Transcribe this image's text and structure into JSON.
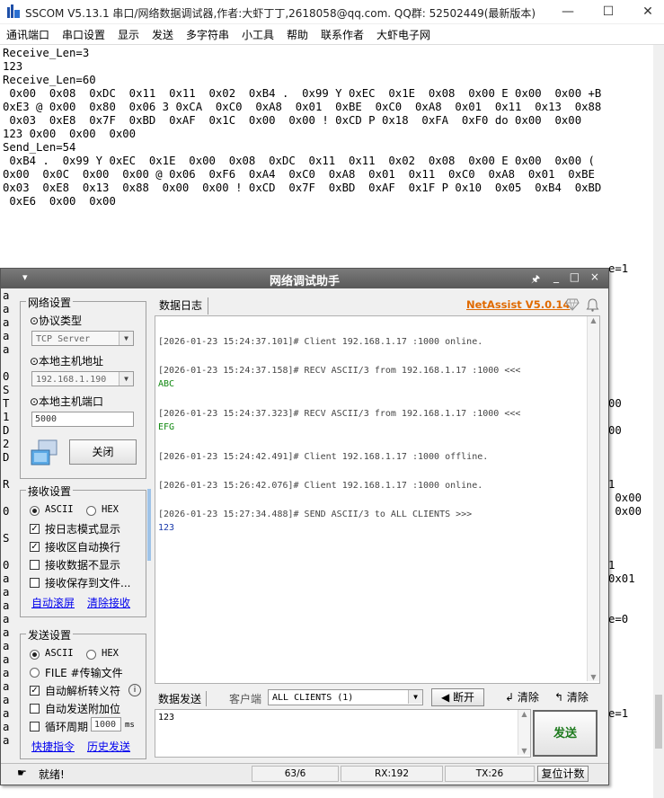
{
  "sscom": {
    "title": "SSCOM V5.13.1 串口/网络数据调试器,作者:大虾丁丁,2618058@qq.com. QQ群: 52502449(最新版本)",
    "menu": [
      "通讯端口",
      "串口设置",
      "显示",
      "发送",
      "多字符串",
      "小工具",
      "帮助",
      "联系作者",
      "大虾电子网"
    ],
    "window_controls": {
      "minimize": "—",
      "maximize": "☐",
      "close": "✕"
    },
    "text_lines": [
      "Receive_Len=3",
      "123",
      "",
      "Receive_Len=60",
      " 0x00  0x08  0xDC  0x11  0x11  0x02  0xB4 .  0x99 Y 0xEC  0x1E  0x08  0x00 E 0x00  0x00 +B",
      "0xE3 @ 0x00  0x80  0x06 3 0xCA  0xC0  0xA8  0x01  0xBE  0xC0  0xA8  0x01  0x11  0x13  0x88",
      " 0x03  0xE8  0x7F  0xBD  0xAF  0x1C  0x00  0x00 ! 0xCD P 0x18  0xFA  0xF0 do 0x00  0x00",
      "123 0x00  0x00  0x00",
      "",
      "Send_Len=54",
      " 0xB4 .  0x99 Y 0xEC  0x1E  0x00  0x08  0xDC  0x11  0x11  0x02  0x08  0x00 E 0x00  0x00 (",
      "0x00  0x0C  0x00  0x00 @ 0x06  0xF6  0xA4  0xC0  0xA8  0x01  0x11  0xC0  0xA8  0x01  0xBE",
      "0x03  0xE8  0x13  0x88  0x00  0x00 ! 0xCD  0x7F  0xBD  0xAF  0x1F P 0x10  0x05  0xB4  0xBD",
      " 0xE6  0x00  0x00"
    ],
    "left_edge_chars": [
      "a",
      "a",
      "a",
      "a",
      "a",
      "",
      "0",
      "S",
      "T",
      "1",
      "D",
      "2",
      "D",
      "",
      "R",
      "",
      "0",
      "",
      "S",
      "",
      "0",
      "a",
      "a",
      "a",
      "a",
      "a",
      "a",
      "a",
      "a",
      "a",
      "a",
      "a",
      "a",
      "a"
    ],
    "right_edge_fragments": [
      "e=1",
      "00",
      "00",
      "1",
      " 0x00",
      " 0x00",
      "1",
      "0x01",
      "e=0",
      "e=1"
    ]
  },
  "netassist": {
    "title": "网络调试助手",
    "sys_menu": "▾",
    "pin": "🖈",
    "title_buttons": "_ □ ×",
    "brand": "NetAssist V5.0.14",
    "net_settings": {
      "group_title": "网络设置",
      "protocol_label": "⊙协议类型",
      "protocol_value": "TCP Server",
      "host_label": "⊙本地主机地址",
      "host_value": "192.168.1.190",
      "port_label": "⊙本地主机端口",
      "port_value": "5000",
      "close_button": "关闭"
    },
    "recv_settings": {
      "group_title": "接收设置",
      "ascii": "ASCII",
      "hex": "HEX",
      "opt_log_mode": "按日志模式显示",
      "opt_auto_wrap": "接收区自动换行",
      "opt_no_display": "接收数据不显示",
      "opt_save_file": "接收保存到文件...",
      "auto_scroll": "自动滚屏",
      "clear_recv": "清除接收"
    },
    "send_settings": {
      "group_title": "发送设置",
      "ascii": "ASCII",
      "hex": "HEX",
      "file_send": "FILE #传输文件",
      "auto_escape": "自动解析转义符",
      "append_checksum": "自动发送附加位",
      "cycle_label": "循环周期",
      "cycle_value": "1000",
      "cycle_unit": "ms",
      "shortcuts": "快捷指令",
      "history": "历史发送"
    },
    "log_tab": "数据日志",
    "log_lines": [
      {
        "text": "[2026-01-23 15:24:37.101]# Client 192.168.1.17 :1000 online.",
        "kind": "normal"
      },
      {
        "text": "[2026-01-23 15:24:37.158]# RECV ASCII/3 from 192.168.1.17 :1000 <<<",
        "kind": "normal"
      },
      {
        "text": "ABC",
        "kind": "green"
      },
      {
        "text": "[2026-01-23 15:24:37.323]# RECV ASCII/3 from 192.168.1.17 :1000 <<<",
        "kind": "normal"
      },
      {
        "text": "EFG",
        "kind": "green"
      },
      {
        "text": "[2026-01-23 15:24:42.491]# Client 192.168.1.17 :1000 offline.",
        "kind": "normal"
      },
      {
        "text": "[2026-01-23 15:26:42.076]# Client 192.168.1.17 :1000 online.",
        "kind": "normal"
      },
      {
        "text": "[2026-01-23 15:27:34.488]# SEND ASCII/3 to ALL CLIENTS >>>",
        "kind": "normal"
      },
      {
        "text": "123",
        "kind": "blue"
      }
    ],
    "send_tab": "数据发送",
    "client_label": "客户端",
    "client_value": "ALL CLIENTS (1)",
    "disconnect_button": "断开",
    "clear1": "清除",
    "clear2": "清除",
    "send_text": "123",
    "send_button": "发送",
    "status": {
      "ready": "就绪!",
      "count": "63/6",
      "rx": "RX:192",
      "tx": "TX:26",
      "reset": "复位计数"
    }
  }
}
